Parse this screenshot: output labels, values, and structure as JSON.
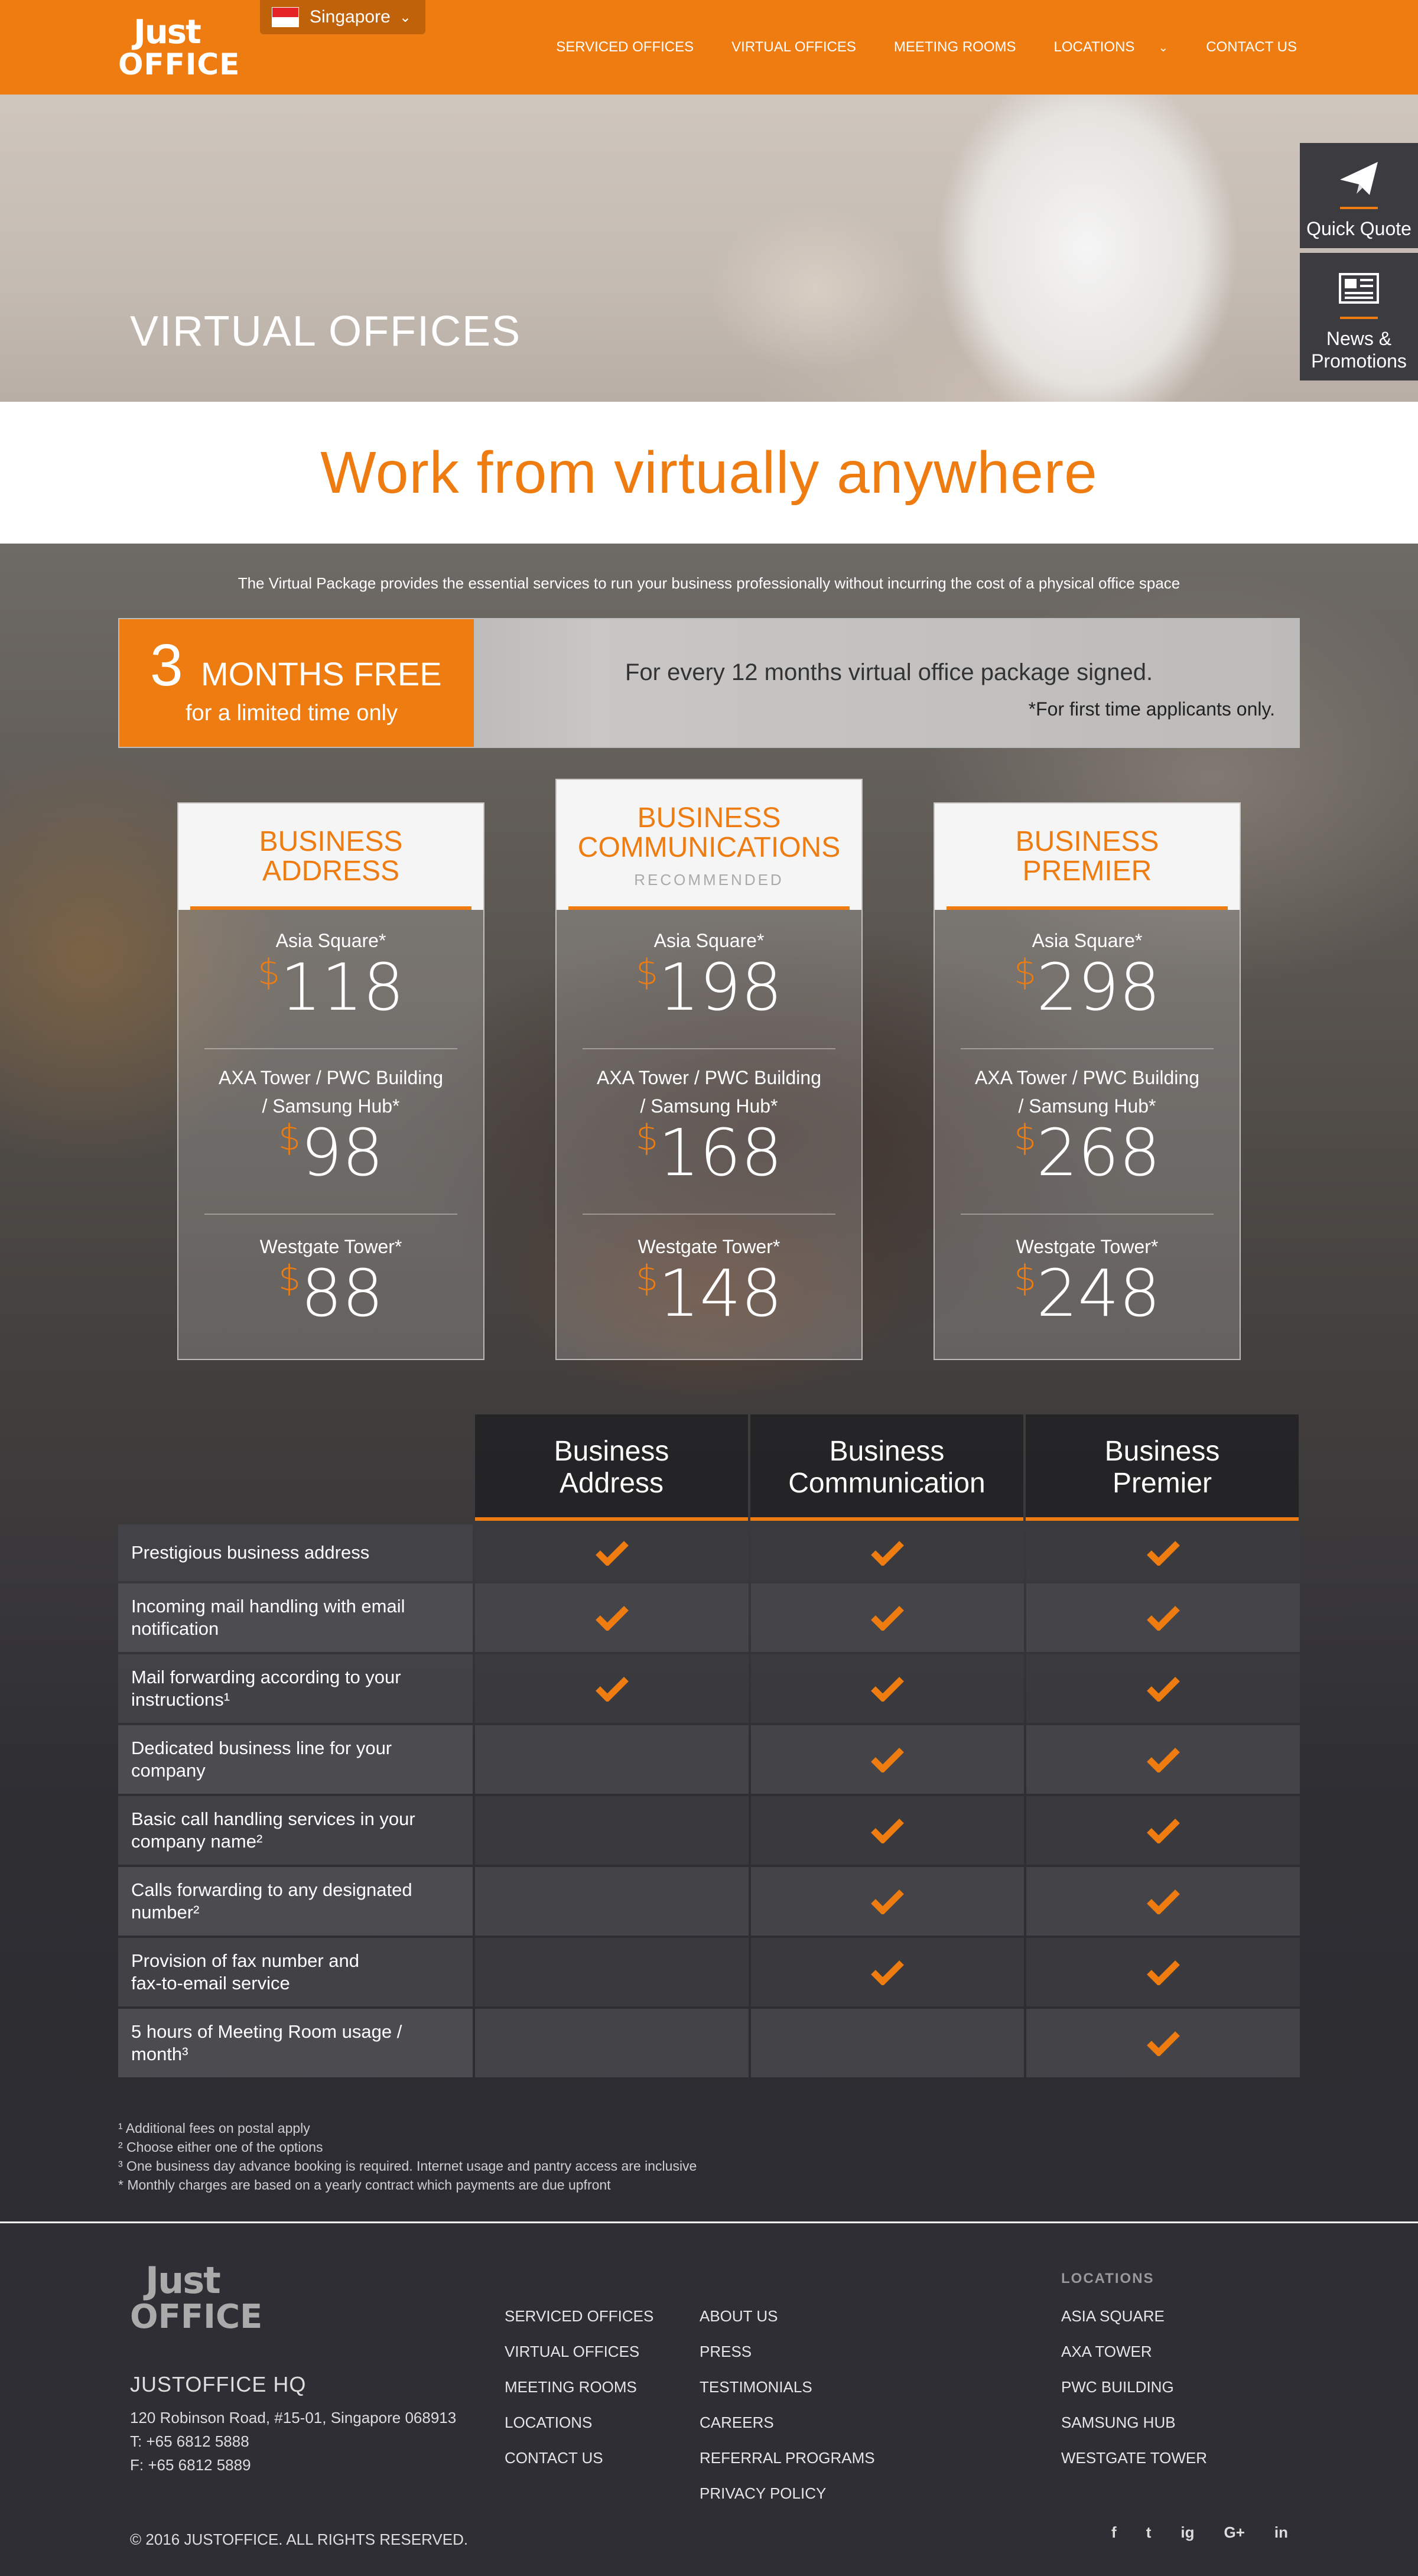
{
  "header": {
    "country": "Singapore",
    "nav": [
      "SERVICED OFFICES",
      "VIRTUAL OFFICES",
      "MEETING ROOMS",
      "LOCATIONS",
      "CONTACT US"
    ]
  },
  "brand": {
    "just": "Just",
    "office": "OFFICE"
  },
  "hero": {
    "title": "VIRTUAL OFFICES"
  },
  "side_tabs": {
    "quote": "Quick Quote",
    "news_line1": "News &",
    "news_line2": "Promotions"
  },
  "tagline": "Work from virtually anywhere",
  "intro": "The Virtual Package provides the essential services to run your business professionally without incurring the cost of a physical office space",
  "promo": {
    "number": "3",
    "months": "MONTHS FREE",
    "sub": "for a limited time only",
    "text": "For every 12 months virtual office package signed.",
    "note": "*For first time applicants only."
  },
  "currency": "$",
  "cards": [
    {
      "title_line1": "BUSINESS",
      "title_line2": "ADDRESS",
      "recommended": "",
      "prices": [
        {
          "loc1": "Asia Square*",
          "loc2": "",
          "value": "118"
        },
        {
          "loc1": "AXA Tower / PWC Building",
          "loc2": "/ Samsung Hub*",
          "value": "98"
        },
        {
          "loc1": "Westgate Tower*",
          "loc2": "",
          "value": "88"
        }
      ]
    },
    {
      "title_line1": "BUSINESS",
      "title_line2": "COMMUNICATIONS",
      "recommended": "RECOMMENDED",
      "prices": [
        {
          "loc1": "Asia Square*",
          "loc2": "",
          "value": "198"
        },
        {
          "loc1": "AXA Tower / PWC Building",
          "loc2": "/ Samsung Hub*",
          "value": "168"
        },
        {
          "loc1": "Westgate Tower*",
          "loc2": "",
          "value": "148"
        }
      ]
    },
    {
      "title_line1": "BUSINESS",
      "title_line2": "PREMIER",
      "recommended": "",
      "prices": [
        {
          "loc1": "Asia Square*",
          "loc2": "",
          "value": "298"
        },
        {
          "loc1": "AXA Tower / PWC Building",
          "loc2": "/ Samsung Hub*",
          "value": "268"
        },
        {
          "loc1": "Westgate Tower*",
          "loc2": "",
          "value": "248"
        }
      ]
    }
  ],
  "comparison": {
    "columns": [
      {
        "line1": "Business",
        "line2": "Address"
      },
      {
        "line1": "Business",
        "line2": "Communication"
      },
      {
        "line1": "Business",
        "line2": "Premier"
      }
    ],
    "rows": [
      {
        "label1": "Prestigious business address",
        "label2": "",
        "checks": [
          true,
          true,
          true
        ]
      },
      {
        "label1": "Incoming mail handling with email",
        "label2": "notification",
        "checks": [
          true,
          true,
          true
        ]
      },
      {
        "label1": "Mail forwarding according to your",
        "label2": "instructions¹",
        "checks": [
          true,
          true,
          true
        ]
      },
      {
        "label1": "Dedicated business line for your",
        "label2": "company",
        "checks": [
          false,
          true,
          true
        ]
      },
      {
        "label1": "Basic call handling services in your",
        "label2": "company name²",
        "checks": [
          false,
          true,
          true
        ]
      },
      {
        "label1": "Calls forwarding to any designated",
        "label2": "number²",
        "checks": [
          false,
          true,
          true
        ]
      },
      {
        "label1": "Provision of fax number and",
        "label2": "fax-to-email service",
        "checks": [
          false,
          true,
          true
        ]
      },
      {
        "label1": "5 hours of Meeting Room usage /",
        "label2": "month³",
        "checks": [
          false,
          false,
          true
        ]
      }
    ]
  },
  "footnotes": [
    "¹  Additional fees on postal apply",
    "²  Choose either one of the options",
    "³  One business day advance booking is required. Internet usage and pantry access are inclusive",
    "*  Monthly charges are based on a yearly contract which payments are due upfront"
  ],
  "footer": {
    "hq_title": "JUSTOFFICE HQ",
    "address": "120 Robinson Road, #15-01, Singapore 068913",
    "tel": "T: +65 6812 5888",
    "fax": "F: +65 6812 5889",
    "col1": [
      "SERVICED OFFICES",
      "VIRTUAL OFFICES",
      "MEETING ROOMS",
      "LOCATIONS",
      "CONTACT US"
    ],
    "col2": [
      "ABOUT US",
      "PRESS",
      "TESTIMONIALS",
      "CAREERS",
      "REFERRAL PROGRAMS",
      "PRIVACY POLICY"
    ],
    "locations_title": "LOCATIONS",
    "locations": [
      "ASIA SQUARE",
      "AXA TOWER",
      "PWC BUILDING",
      "SAMSUNG HUB",
      "WESTGATE TOWER"
    ],
    "copyright": "© 2016 JUSTOFFICE. ALL RIGHTS RESERVED.",
    "social": [
      "f",
      "t",
      "ig",
      "G+",
      "in"
    ]
  },
  "colors": {
    "accent": "#ee7c10",
    "dark": "#2c2c32"
  }
}
